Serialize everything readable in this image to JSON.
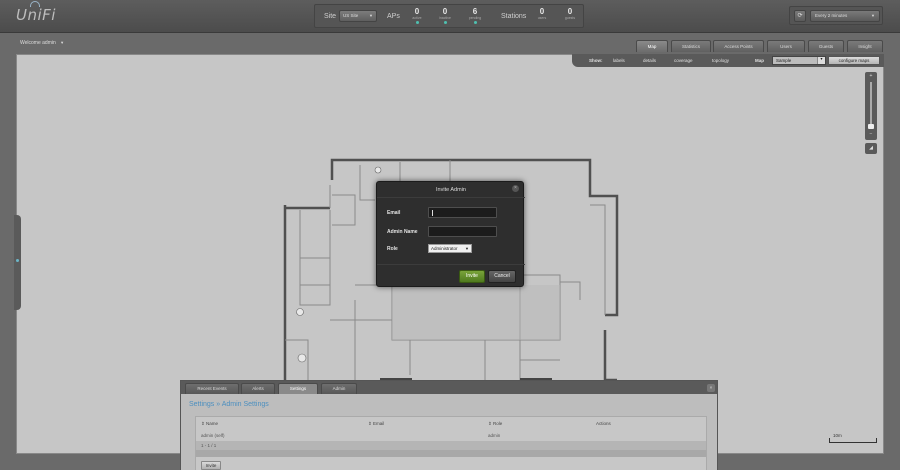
{
  "app": {
    "logo": "UniFi"
  },
  "stats": {
    "site_label": "Site",
    "site_value": "US Site",
    "aps_label": "APs",
    "stations_label": "Stations",
    "aps": [
      {
        "num": "0",
        "lbl": "active"
      },
      {
        "num": "0",
        "lbl": "inactive"
      },
      {
        "num": "6",
        "lbl": "pending"
      }
    ],
    "stations": [
      {
        "num": "0",
        "lbl": "users"
      },
      {
        "num": "0",
        "lbl": "guests"
      }
    ]
  },
  "refresh": {
    "value": "Every 2 minutes"
  },
  "header": {
    "welcome": "Welcome admin"
  },
  "tabs": [
    "Map",
    "Statistics",
    "Access Points",
    "Users",
    "Guests",
    "Insight"
  ],
  "map_toolbar": {
    "show_label": "Show:",
    "options": [
      "labels",
      "details",
      "coverage",
      "topology"
    ],
    "map_label": "Map",
    "map_value": "Sample",
    "configure": "configure maps"
  },
  "map": {
    "scale": "10m"
  },
  "modal": {
    "title": "Invite Admin",
    "email_label": "Email",
    "email_value": "",
    "name_label": "Admin Name",
    "name_value": "",
    "role_label": "Role",
    "role_value": "Administrator",
    "invite": "Invite",
    "cancel": "Cancel"
  },
  "panel": {
    "tabs": [
      "Recent Events",
      "Alerts",
      "Settings",
      "Admin"
    ],
    "breadcrumb": "Settings » Admin Settings",
    "columns": [
      "Name",
      "Email",
      "Role",
      "Actions"
    ],
    "rows": [
      {
        "name": "admin (self)",
        "email": "",
        "role": "admin",
        "actions": ""
      }
    ],
    "pager": "1 - 1 / 1",
    "invite": "Invite"
  },
  "colors": {
    "accent_green": "#5d8a25",
    "link_blue": "#4c8fbf",
    "stat_dot": "#4fc0b0"
  }
}
